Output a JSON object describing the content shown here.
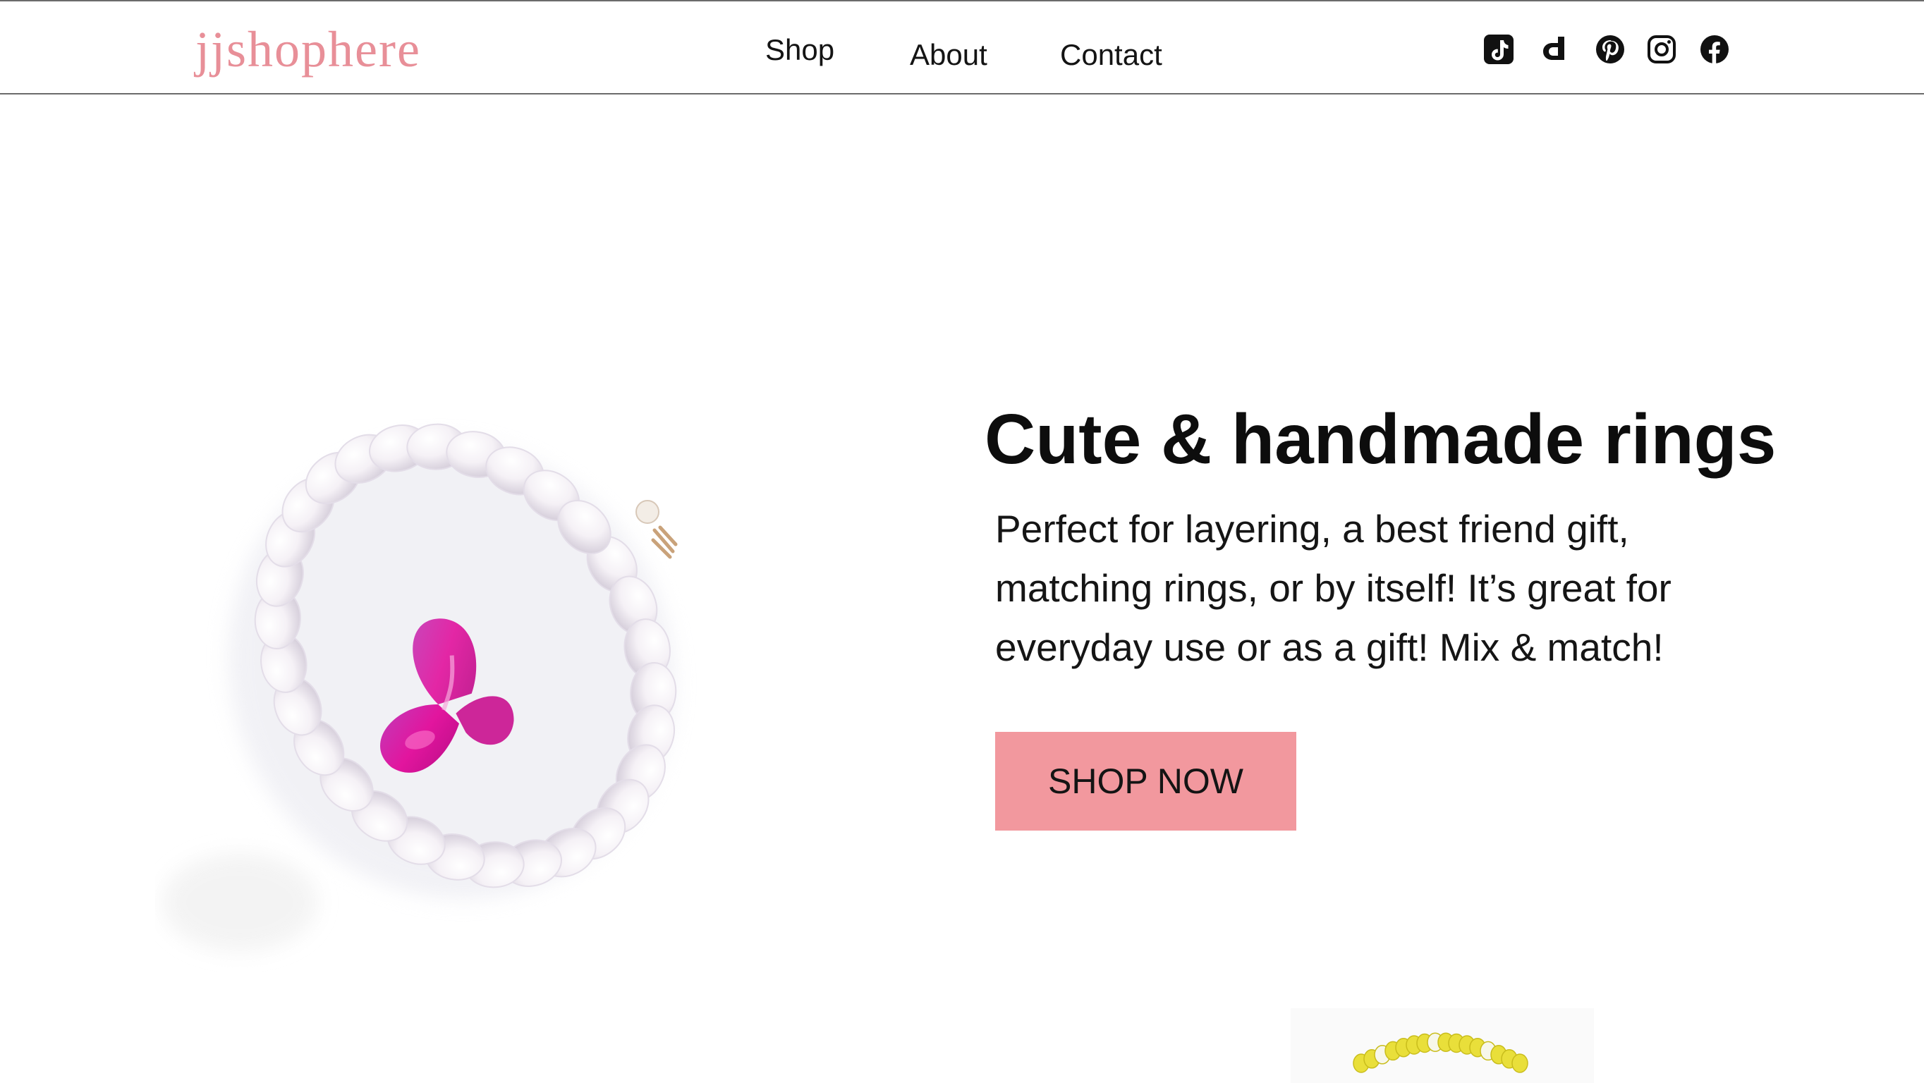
{
  "header": {
    "logo": "jjshophere",
    "nav": [
      {
        "label": "Shop"
      },
      {
        "label": "About"
      },
      {
        "label": "Contact"
      }
    ],
    "social_icons": [
      "tiktok-icon",
      "depop-icon",
      "pinterest-icon",
      "instagram-icon",
      "facebook-icon"
    ]
  },
  "hero": {
    "title": "Cute & handmade rings",
    "description": "Perfect for layering, a best friend gift, matching rings, or by itself! It’s great for everyday use or as a gift! Mix & match!",
    "cta_label": "SHOP NOW",
    "image": "white-pearl-bead-ring-with-pink-butterfly"
  },
  "next_section": {
    "image": "yellow-bead-ring"
  },
  "colors": {
    "brand_pink": "#e88f98",
    "button_pink": "#f2989e",
    "butterfly_magenta": "#d2149e",
    "text": "#111111",
    "header_border": "#6b6b6b"
  }
}
